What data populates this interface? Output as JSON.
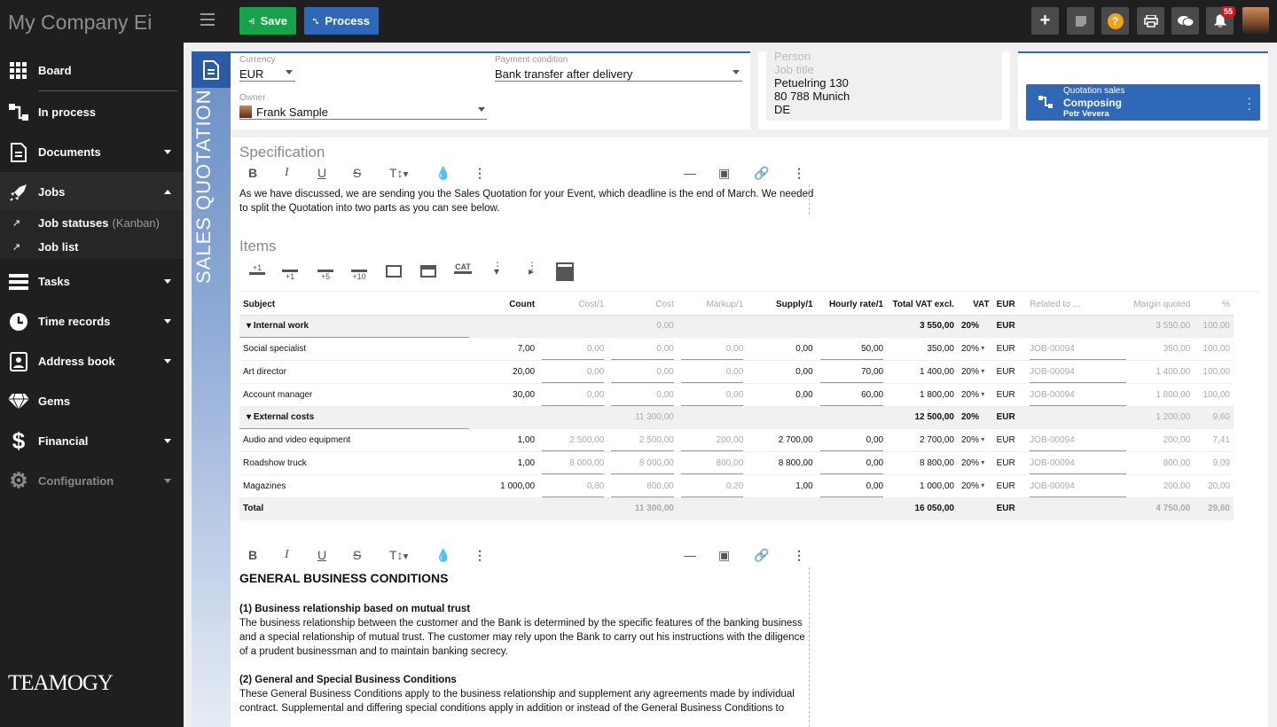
{
  "topbar": {
    "brand": "My Company Ei",
    "save": "Save",
    "process": "Process",
    "notifications": "55"
  },
  "sidebar": {
    "items": [
      {
        "label": "Board",
        "icon": "grid-icon"
      },
      {
        "label": "In process",
        "icon": "process-icon"
      },
      {
        "label": "Documents",
        "icon": "document-icon"
      },
      {
        "label": "Jobs",
        "icon": "rocket-icon"
      },
      {
        "label": "Tasks",
        "icon": "tasks-icon"
      },
      {
        "label": "Time records",
        "icon": "clock-icon"
      },
      {
        "label": "Address book",
        "icon": "contact-icon"
      },
      {
        "label": "Gems",
        "icon": "gem-icon"
      },
      {
        "label": "Financial",
        "icon": "dollar-icon"
      },
      {
        "label": "Configuration",
        "icon": "gear-icon"
      }
    ],
    "sub": {
      "statuses": "Job statuses",
      "statuses_hint": "(Kanban)",
      "list": "Job list"
    },
    "logo": "TEAMOGY"
  },
  "doc": {
    "vertical_label": "SALES QUOTATION",
    "currency_label": "Currency",
    "currency": "EUR",
    "payment_label": "Payment condition",
    "payment": "Bank transfer after delivery",
    "owner_label": "Owner",
    "owner": "Frank Sample",
    "person_ph": "Person",
    "jobtitle_ph": "Job title",
    "address": [
      "Petuelring 130",
      "80 788 Munich",
      "DE"
    ],
    "status": {
      "title": "Quotation sales",
      "state": "Composing",
      "user": "Petr Vevera"
    }
  },
  "spec": {
    "title": "Specification",
    "text1": "As we have discussed, we are sending you the Sales Quotation for your Event, which deadline is the end of March.  We needed",
    "text2": "to split the Quotation into two parts as you can see below."
  },
  "items": {
    "title": "Items",
    "toolbar": [
      "+1",
      "+1",
      "+5",
      "+10",
      "",
      "",
      "CAT",
      "",
      ""
    ],
    "headers": [
      "Subject",
      "Count",
      "Cost/1",
      "Cost",
      "Markup/1",
      "Supply/1",
      "Hourly rate/1",
      "Total VAT excl.",
      "VAT",
      "EUR",
      "Related to ...",
      "Margin quoted",
      "%"
    ],
    "rows": [
      {
        "type": "grp",
        "subject": "Internal work",
        "cost": "0,00",
        "total": "3 550,00",
        "vat": "20%",
        "cur": "EUR",
        "margin": "3 550,00",
        "pct": "100,00"
      },
      {
        "type": "row",
        "subject": "Social specialist",
        "count": "7,00",
        "cost1": "0,00",
        "cost": "0,00",
        "markup": "0,00",
        "supply": "0,00",
        "hourly": "50,00",
        "total": "350,00",
        "vat": "20%",
        "cur": "EUR",
        "rel": "JOB-00094",
        "margin": "350,00",
        "pct": "100,00"
      },
      {
        "type": "row",
        "subject": "Art director",
        "count": "20,00",
        "cost1": "0,00",
        "cost": "0,00",
        "markup": "0,00",
        "supply": "0,00",
        "hourly": "70,00",
        "total": "1 400,00",
        "vat": "20%",
        "cur": "EUR",
        "rel": "JOB-00094",
        "margin": "1 400,00",
        "pct": "100,00"
      },
      {
        "type": "row",
        "subject": "Account manager",
        "count": "30,00",
        "cost1": "0,00",
        "cost": "0,00",
        "markup": "0,00",
        "supply": "0,00",
        "hourly": "60,00",
        "total": "1 800,00",
        "vat": "20%",
        "cur": "EUR",
        "rel": "JOB-00094",
        "margin": "1 800,00",
        "pct": "100,00"
      },
      {
        "type": "grp",
        "subject": "External costs",
        "cost": "11 300,00",
        "total": "12 500,00",
        "vat": "20%",
        "cur": "EUR",
        "margin": "1 200,00",
        "pct": "9,60"
      },
      {
        "type": "row",
        "subject": "Audio and video equipment",
        "count": "1,00",
        "cost1": "2 500,00",
        "cost": "2 500,00",
        "markup": "200,00",
        "supply": "2 700,00",
        "hourly": "0,00",
        "total": "2 700,00",
        "vat": "20%",
        "cur": "EUR",
        "rel": "JOB-00094",
        "margin": "200,00",
        "pct": "7,41"
      },
      {
        "type": "row",
        "subject": "Roadshow truck",
        "count": "1,00",
        "cost1": "8 000,00",
        "cost": "8 000,00",
        "markup": "800,00",
        "supply": "8 800,00",
        "hourly": "0,00",
        "total": "8 800,00",
        "vat": "20%",
        "cur": "EUR",
        "rel": "JOB-00094",
        "margin": "800,00",
        "pct": "9,09"
      },
      {
        "type": "row",
        "subject": "Magazines",
        "count": "1 000,00",
        "cost1": "0,80",
        "cost": "800,00",
        "markup": "0,20",
        "supply": "1,00",
        "hourly": "0,00",
        "total": "1 000,00",
        "vat": "20%",
        "cur": "EUR",
        "rel": "JOB-00094",
        "margin": "200,00",
        "pct": "20,00"
      },
      {
        "type": "tot",
        "subject": "Total",
        "cost": "11 300,00",
        "total": "16 050,00",
        "cur": "EUR",
        "margin": "4 750,00",
        "pct": "29,60"
      }
    ]
  },
  "conditions": {
    "heading": "GENERAL BUSINESS CONDITIONS",
    "s1_title": "(1) Business relationship based on mutual trust",
    "s1_l1": "The business relationship between the customer and the Bank is determined by the specific features of the banking business",
    "s1_l2": "and a special relationship of mutual trust. The customer may rely upon the Bank to carry out his instructions with the diligence",
    "s1_l3": "of a prudent businessman and to maintain banking secrecy.",
    "s2_title": "(2) General and Special Business Conditions",
    "s2_l1": "These General Business Conditions apply to the business relationship and supplement any agreements made by individual",
    "s2_l2": "contract. Supplemental and differing special conditions apply in addition or instead of the General Business Conditions to"
  }
}
